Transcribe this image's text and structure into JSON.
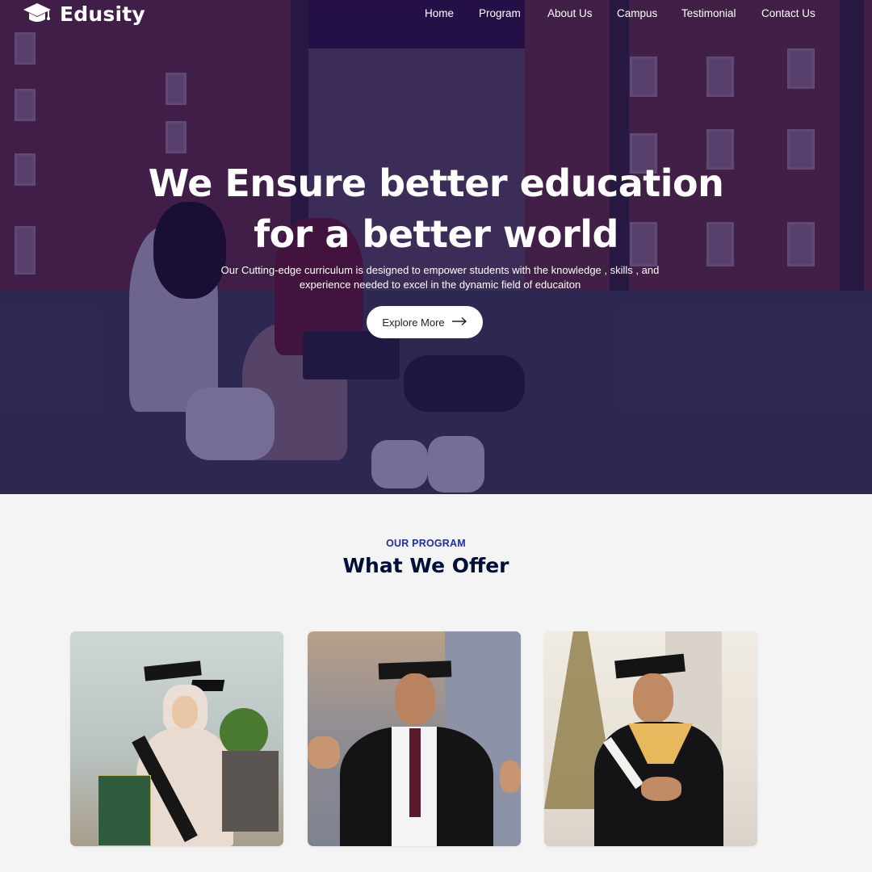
{
  "brand": {
    "name": "Edusity",
    "icon": "graduation-cap-icon"
  },
  "nav": {
    "items": [
      {
        "label": "Home"
      },
      {
        "label": "Program"
      },
      {
        "label": "About Us"
      },
      {
        "label": "Campus"
      },
      {
        "label": "Testimonial"
      },
      {
        "label": "Contact Us"
      }
    ]
  },
  "hero": {
    "title_line1": "We Ensure better education",
    "title_line2": "for a better world",
    "subtitle_line1": "Our Cutting-edge curriculum is designed to empower students with the knowledge , skills , and",
    "subtitle_line2": "experience needed to excel in the dynamic field of educaiton",
    "cta_label": "Explore More",
    "cta_icon": "arrow-right-icon"
  },
  "programs": {
    "eyebrow": "OUR PROGRAM",
    "title": "What We Offer"
  },
  "colors": {
    "overlay": "#160a50",
    "eyebrow": "#212ea0",
    "title": "#000f38",
    "page_bg": "#f4f4f5"
  }
}
